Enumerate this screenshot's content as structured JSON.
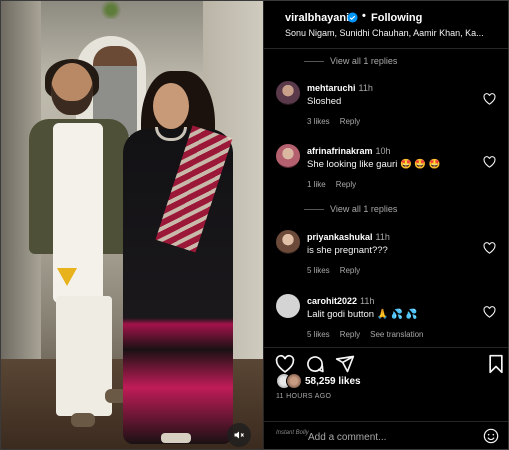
{
  "post": {
    "username": "viralbhayani",
    "dot": "•",
    "follow_status": "Following",
    "audio_subtitle": "Sonu Nigam, Sunidhi Chauhan, Aamir Khan, Ka...",
    "likes": "58,259 likes",
    "posted_time": "11 HOURS AGO",
    "add_comment_placeholder": "Add a comment...",
    "watermark_text": "Instant Bolly"
  },
  "replies_top": "View all 1 replies",
  "replies_mid": "View all 1 replies",
  "comments": [
    {
      "user": "mehtaruchi",
      "time": "11h",
      "text": "Sloshed",
      "likes": "3 likes",
      "reply": "Reply"
    },
    {
      "user": "afrinafrinakram",
      "time": "10h",
      "text": "She looking like gauri 🤩 🤩 🤩",
      "likes": "1 like",
      "reply": "Reply"
    },
    {
      "user": "priyankashukal",
      "time": "11h",
      "text": "is she pregnant???",
      "likes": "5 likes",
      "reply": "Reply"
    },
    {
      "user": "carohit2022",
      "time": "11h",
      "text": "Lalit godi button 🙏 💦 💦",
      "likes": "5 likes",
      "reply": "Reply",
      "extra": "See translation"
    }
  ],
  "colors": {
    "background": "#000000",
    "text": "#f5f5f5",
    "muted": "#a8a8a8",
    "verified": "#0095f6"
  },
  "icons": [
    "verified-badge-icon",
    "heart-icon",
    "comment-icon",
    "share-icon",
    "bookmark-icon",
    "mute-icon",
    "smile-icon"
  ]
}
